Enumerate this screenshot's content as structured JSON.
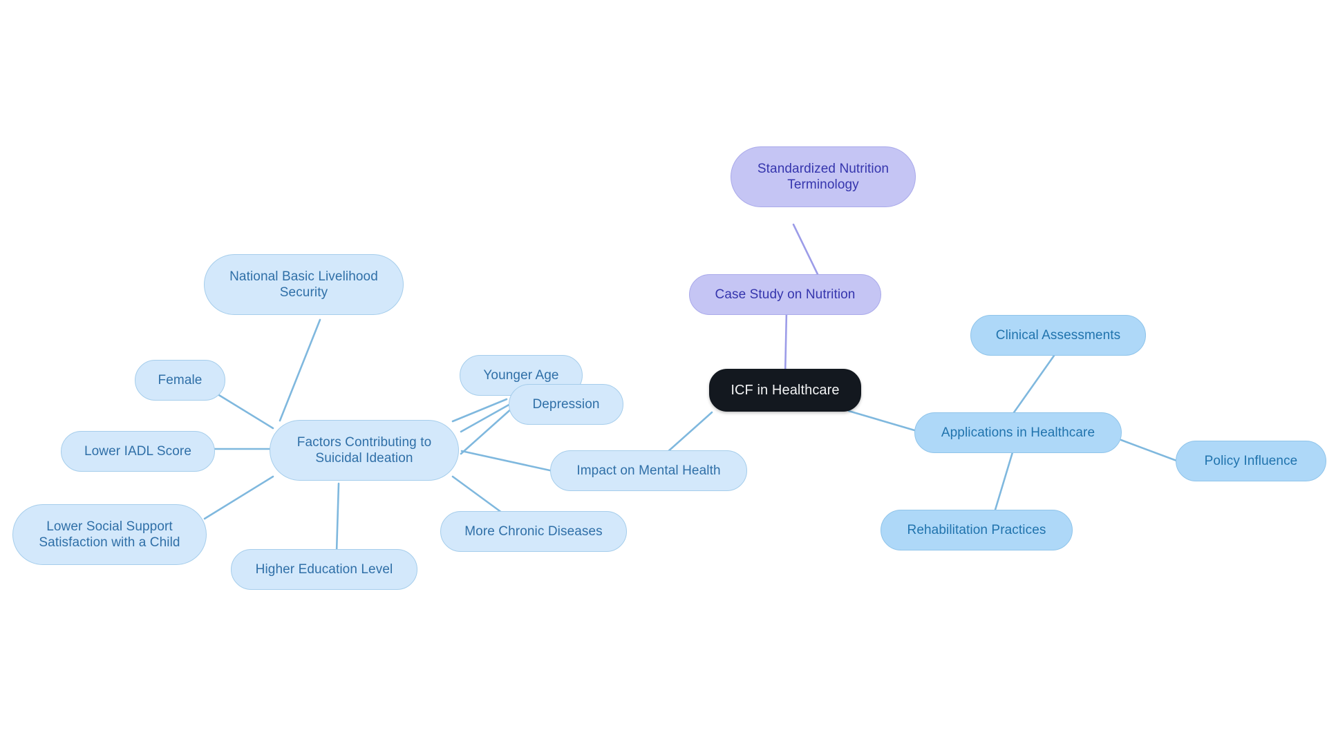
{
  "diagram": {
    "type": "mindmap",
    "title": "ICF in Healthcare",
    "background": "#ffffff",
    "palette": {
      "root_fill": "#13181f",
      "root_text": "#f2f3f4",
      "light_blue_fill": "#d3e8fb",
      "light_blue_border": "#a5cdeb",
      "light_blue_text": "#2f6fa7",
      "medium_blue_fill": "#aed8f8",
      "medium_blue_border": "#8fc4ea",
      "medium_blue_text": "#2073ad",
      "purple_fill": "#c5c5f4",
      "purple_border": "#a9a9ea",
      "purple_text": "#3535ad",
      "edge_blue": "#7fb8de",
      "edge_purple": "#9c9ce8"
    }
  },
  "nodes": {
    "root": {
      "label": "ICF in Healthcare"
    },
    "case_study": {
      "label": "Case Study on Nutrition"
    },
    "standardized_terminology": {
      "label": "Standardized Nutrition\nTerminology"
    },
    "applications": {
      "label": "Applications in Healthcare"
    },
    "clinical_assessments": {
      "label": "Clinical Assessments"
    },
    "policy_influence": {
      "label": "Policy Influence"
    },
    "rehabilitation": {
      "label": "Rehabilitation Practices"
    },
    "mental_health": {
      "label": "Impact on Mental Health"
    },
    "factors": {
      "label": "Factors Contributing to\nSuicidal Ideation"
    },
    "livelihood": {
      "label": "National Basic Livelihood\nSecurity"
    },
    "female": {
      "label": "Female"
    },
    "iadl": {
      "label": "Lower IADL Score"
    },
    "social_support": {
      "label": "Lower Social Support\nSatisfaction with a Child"
    },
    "education": {
      "label": "Higher Education Level"
    },
    "chronic": {
      "label": "More Chronic Diseases"
    },
    "younger_age": {
      "label": "Younger Age"
    },
    "depression": {
      "label": "Depression"
    }
  }
}
